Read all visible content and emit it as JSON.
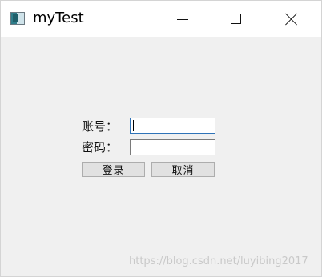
{
  "window": {
    "title": "myTest",
    "icon": "app-icon",
    "controls": {
      "minimize": "minimize-icon",
      "maximize": "maximize-icon",
      "close": "close-icon"
    }
  },
  "form": {
    "account_label": "账号：",
    "password_label": "密码：",
    "account_value": "",
    "password_value": "",
    "login_button": "登录",
    "cancel_button": "取消"
  },
  "watermark": "https://blog.csdn.net/luyibing2017"
}
